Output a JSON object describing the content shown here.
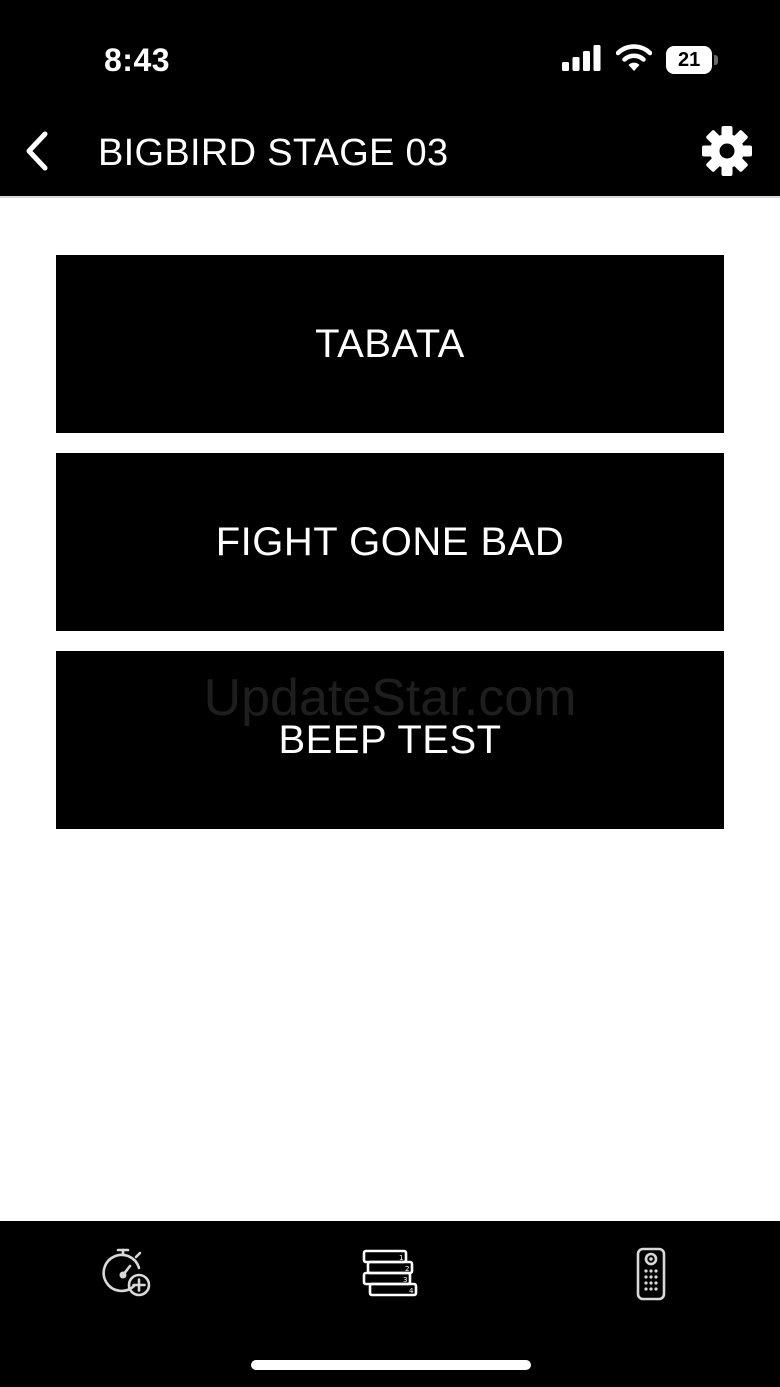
{
  "status_bar": {
    "time": "8:43",
    "battery_level": "21",
    "icons": [
      "cellular-signal-icon",
      "wifi-icon",
      "battery-icon"
    ]
  },
  "nav": {
    "title": "BIGBIRD STAGE 03",
    "back_icon": "chevron-left-icon",
    "settings_icon": "gear-icon"
  },
  "workouts": [
    {
      "label": "TABATA"
    },
    {
      "label": "FIGHT GONE BAD"
    },
    {
      "label": "BEEP TEST"
    }
  ],
  "watermark": "UpdateStar.com",
  "tab_bar": {
    "items": [
      {
        "icon": "stopwatch-add-icon"
      },
      {
        "icon": "stacked-list-icon"
      },
      {
        "icon": "remote-control-icon"
      }
    ]
  },
  "colors": {
    "bar_background": "#000000",
    "page_background": "#ffffff",
    "button_background": "#000000",
    "button_text": "#ffffff"
  }
}
